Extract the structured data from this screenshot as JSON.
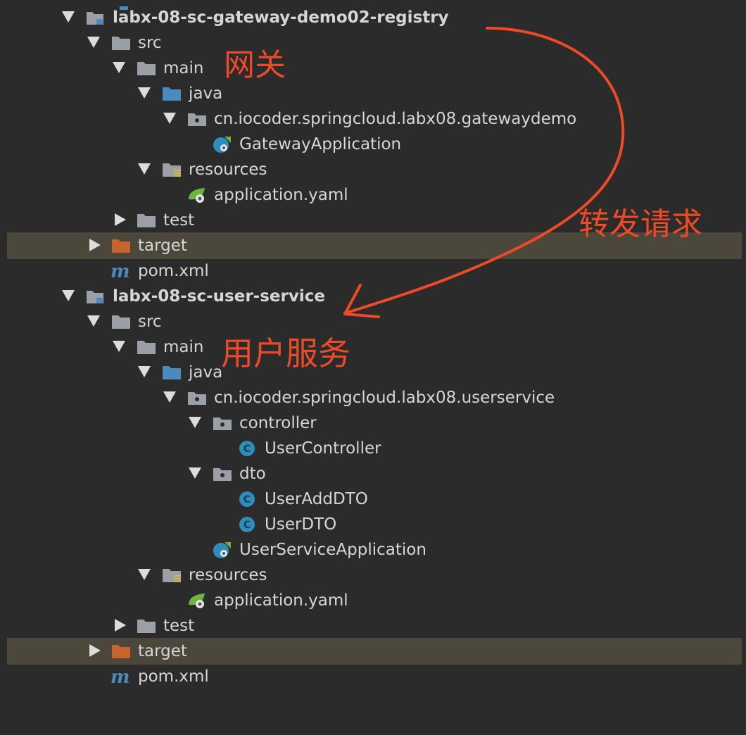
{
  "tree": [
    {
      "label": "labx-08-sc-gateway-demo02-registry",
      "icon": "module-folder-icon",
      "expand": "open",
      "bold": true
    },
    {
      "label": "src",
      "icon": "folder-icon",
      "expand": "open"
    },
    {
      "label": "main",
      "icon": "folder-icon",
      "expand": "open"
    },
    {
      "label": "java",
      "icon": "source-folder-icon",
      "expand": "open"
    },
    {
      "label": "cn.iocoder.springcloud.labx08.gatewaydemo",
      "icon": "package-icon",
      "expand": "open"
    },
    {
      "label": "GatewayApplication",
      "icon": "spring-boot-class-icon",
      "expand": "none"
    },
    {
      "label": "resources",
      "icon": "resources-folder-icon",
      "expand": "open"
    },
    {
      "label": "application.yaml",
      "icon": "spring-config-icon",
      "expand": "none"
    },
    {
      "label": "test",
      "icon": "folder-icon",
      "expand": "closed"
    },
    {
      "label": "target",
      "icon": "excluded-folder-icon",
      "expand": "closed",
      "highlight": true
    },
    {
      "label": "pom.xml",
      "icon": "maven-icon",
      "expand": "none"
    },
    {
      "label": "labx-08-sc-user-service",
      "icon": "module-folder-icon",
      "expand": "open",
      "bold": true
    },
    {
      "label": "src",
      "icon": "folder-icon",
      "expand": "open"
    },
    {
      "label": "main",
      "icon": "folder-icon",
      "expand": "open"
    },
    {
      "label": "java",
      "icon": "source-folder-icon",
      "expand": "open"
    },
    {
      "label": "cn.iocoder.springcloud.labx08.userservice",
      "icon": "package-icon",
      "expand": "open"
    },
    {
      "label": "controller",
      "icon": "package-icon",
      "expand": "open"
    },
    {
      "label": "UserController",
      "icon": "class-icon",
      "expand": "none"
    },
    {
      "label": "dto",
      "icon": "package-icon",
      "expand": "open"
    },
    {
      "label": "UserAddDTO",
      "icon": "class-icon",
      "expand": "none"
    },
    {
      "label": "UserDTO",
      "icon": "class-icon",
      "expand": "none"
    },
    {
      "label": "UserServiceApplication",
      "icon": "spring-boot-class-icon",
      "expand": "none"
    },
    {
      "label": "resources",
      "icon": "resources-folder-icon",
      "expand": "open"
    },
    {
      "label": "application.yaml",
      "icon": "spring-config-icon",
      "expand": "none"
    },
    {
      "label": "test",
      "icon": "folder-icon",
      "expand": "closed"
    },
    {
      "label": "target",
      "icon": "excluded-folder-icon",
      "expand": "closed",
      "highlight": true
    },
    {
      "label": "pom.xml",
      "icon": "maven-icon",
      "expand": "none"
    }
  ],
  "annotations": {
    "gateway": "网关",
    "forward": "转发请求",
    "user_service": "用户服务"
  },
  "colors": {
    "background": "#2b2b2b",
    "highlight_row": "#4b473b",
    "text": "#d6d6d6",
    "folder": "#9aa0a6",
    "source_folder": "#4a8bbf",
    "excluded_folder": "#c8632b",
    "class_circle": "#2f8dbb",
    "spring_green": "#6db33f",
    "annotation": "#ef4a28"
  }
}
